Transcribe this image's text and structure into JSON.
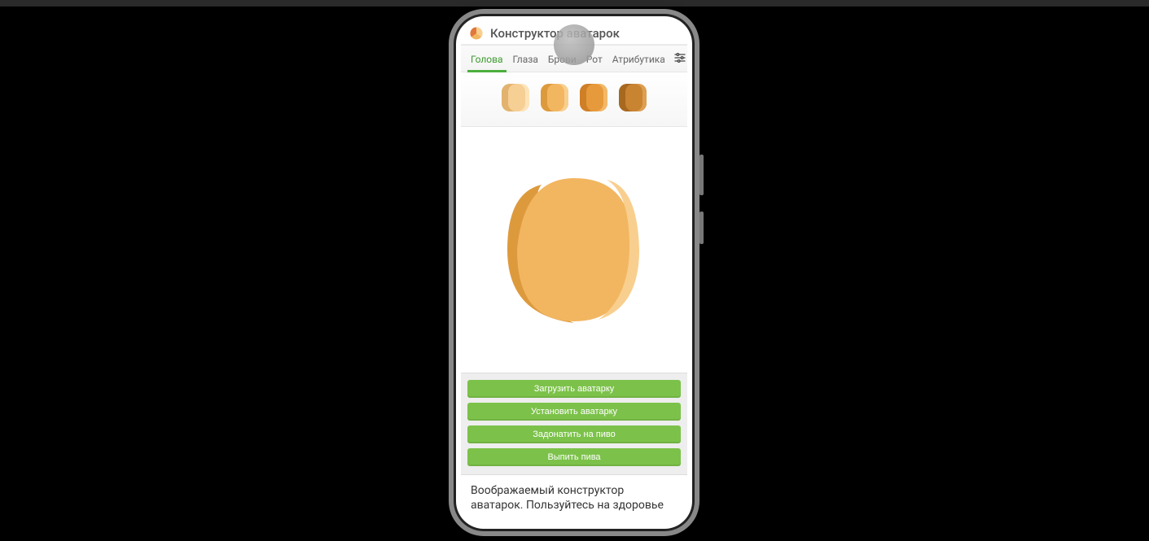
{
  "header": {
    "title": "Конструктор аватарок"
  },
  "tabs": [
    {
      "label": "Голова",
      "active": true
    },
    {
      "label": "Глаза",
      "active": false
    },
    {
      "label": "Брови",
      "active": false
    },
    {
      "label": "Рот",
      "active": false
    },
    {
      "label": "Атрибутика",
      "active": false
    }
  ],
  "swatches": [
    {
      "main": "#f6cf95",
      "shade": "#e2b36e",
      "highlight": "#fde3b8"
    },
    {
      "main": "#f2b661",
      "shade": "#dd9a3d",
      "highlight": "#f8cf8e"
    },
    {
      "main": "#e79a3c",
      "shade": "#cf7f26",
      "highlight": "#f3b868"
    },
    {
      "main": "#c98431",
      "shade": "#a76820",
      "highlight": "#de9e50"
    }
  ],
  "previewColor": {
    "main": "#f2b661",
    "shade": "#dd9a3d",
    "highlight": "#f8cf8e"
  },
  "buttons": {
    "download": "Загрузить аватарку",
    "set": "Установить аватарку",
    "donate": "Задонатить на пиво",
    "drink": "Выпить пива"
  },
  "footer": {
    "text": "Воображаемый конструктор аватарок. Пользуйтесь на здоровье"
  }
}
